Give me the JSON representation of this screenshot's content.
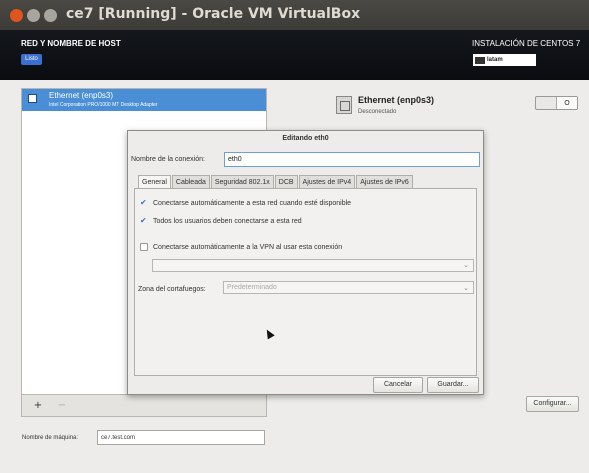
{
  "window": {
    "title": "ce7 [Running] - Oracle VM VirtualBox"
  },
  "header": {
    "left_title": "RED Y NOMBRE DE HOST",
    "done_label": "Listo",
    "right_title": "INSTALACIÓN DE CENTOS 7",
    "keyboard_layout": "latam"
  },
  "interfaces": {
    "items": [
      {
        "name": "Ethernet (enp0s3)",
        "description": "Intel Corporation PRO/1000 MT Desktop Adapter"
      }
    ],
    "add_label": "+",
    "remove_label": "−"
  },
  "device": {
    "name": "Ethernet (enp0s3)",
    "status": "Desconectado",
    "toggle_label": "O"
  },
  "configure_label": "Configurar...",
  "hostname": {
    "label": "Nombre de máquina:",
    "value": "ce7.test.com"
  },
  "dialog": {
    "title": "Editando eth0",
    "connection_label": "Nombre de la conexión:",
    "connection_value": "eth0",
    "tabs": [
      {
        "label": "General"
      },
      {
        "label": "Cableada"
      },
      {
        "label": "Seguridad 802.1x"
      },
      {
        "label": "DCB"
      },
      {
        "label": "Ajustes de IPv4"
      },
      {
        "label": "Ajustes de IPv6"
      }
    ],
    "options": [
      {
        "label": "Conectarse automáticamente a esta red cuando esté disponible",
        "checked": true
      },
      {
        "label": "Todos los usuarios deben conectarse a esta red",
        "checked": true
      },
      {
        "label": "Conectarse automáticamente a la VPN al usar esta conexión",
        "checked": false
      }
    ],
    "firewall_label": "Zona del cortafuegos:",
    "firewall_value": "Predeterminado",
    "cancel_label": "Cancelar",
    "save_label": "Guardar..."
  },
  "colors": {
    "accent": "#4a8fd6",
    "done_button": "#3b6fd0",
    "close_button": "#e0541e"
  }
}
